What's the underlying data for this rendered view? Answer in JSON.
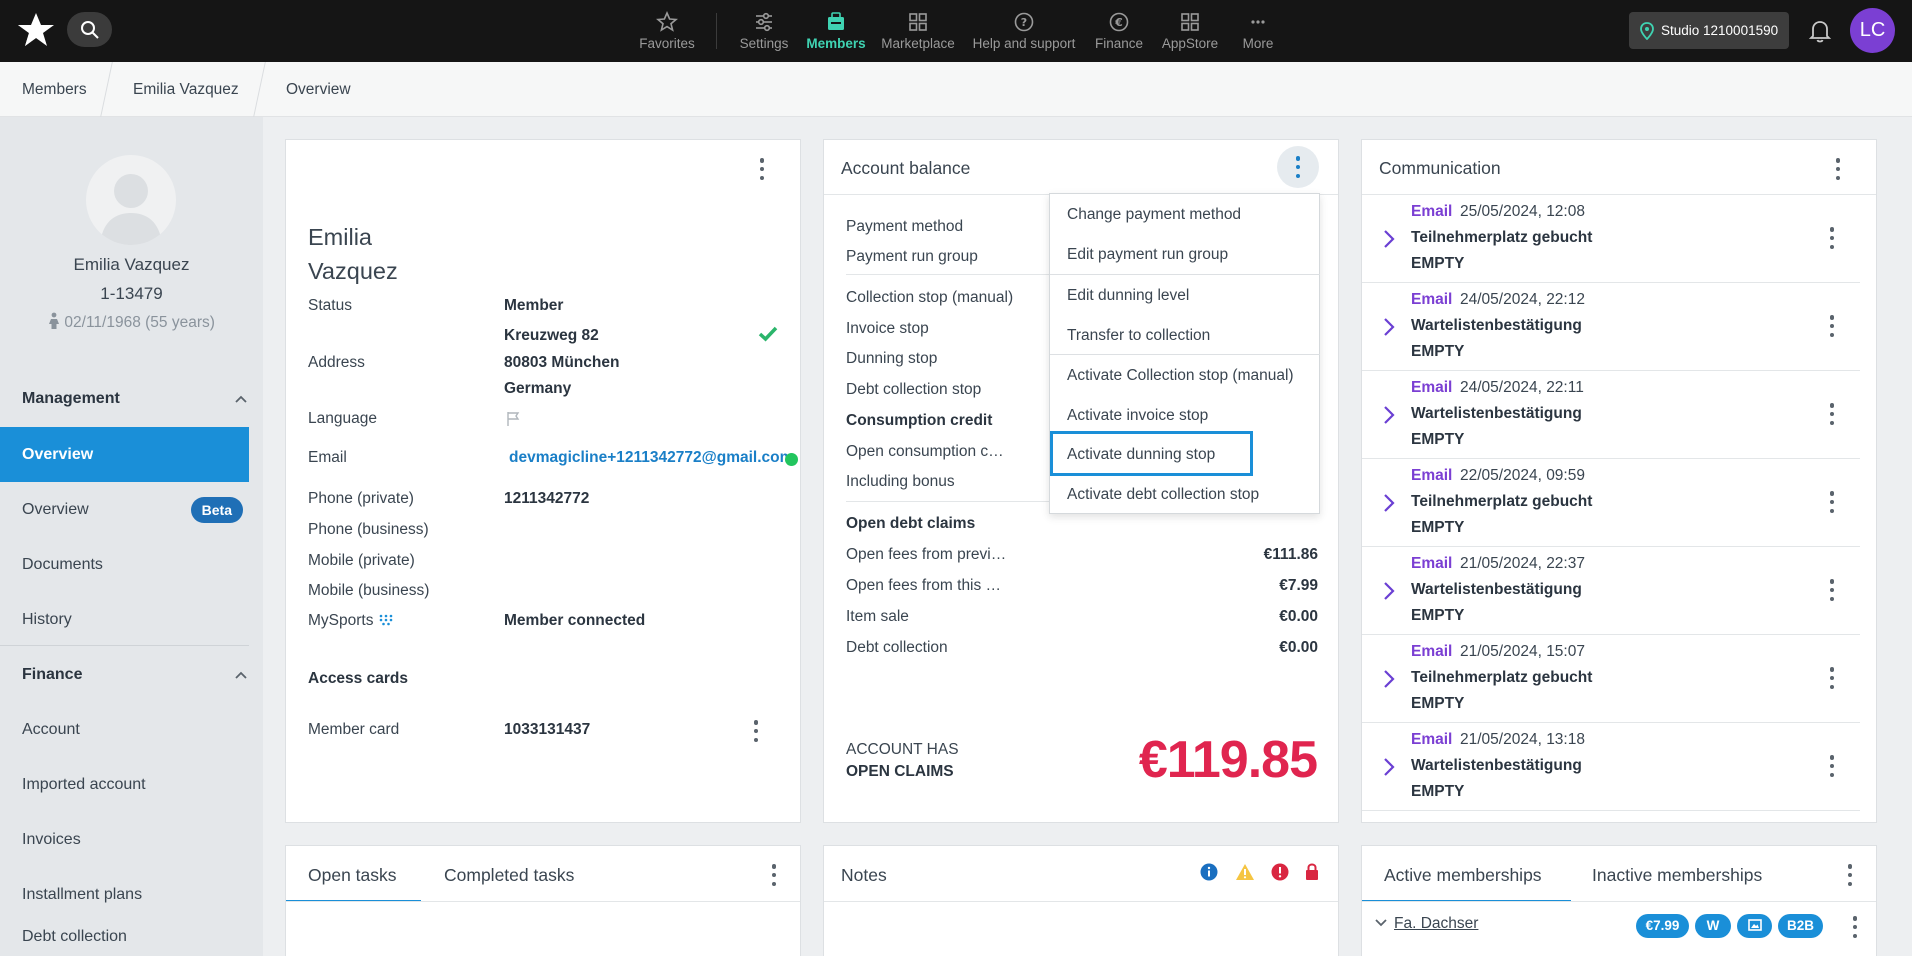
{
  "topbar": {
    "nav": [
      {
        "label": "Favorites",
        "icon": "star-icon"
      },
      {
        "label": "Settings",
        "icon": "sliders-icon"
      },
      {
        "label": "Members",
        "icon": "members-icon"
      },
      {
        "label": "Marketplace",
        "icon": "grid-icon"
      },
      {
        "label": "Help and support",
        "icon": "help-icon"
      },
      {
        "label": "Finance",
        "icon": "euro-icon"
      },
      {
        "label": "AppStore",
        "icon": "appstore-icon"
      },
      {
        "label": "More",
        "icon": "more-icon"
      }
    ],
    "studio": "Studio 1210001590",
    "user_initials": "LC",
    "accent": "#3fd3b2"
  },
  "breadcrumb": [
    "Members",
    "Emilia Vazquez",
    "Overview"
  ],
  "sidebar": {
    "name": "Emilia Vazquez",
    "member_number": "1-13479",
    "birthdate": "02/11/1968 (55 years)",
    "sections": [
      {
        "title": "Management",
        "items": [
          "Overview",
          "Overview",
          "Documents",
          "History"
        ],
        "badge": "Beta"
      },
      {
        "title": "Finance",
        "items": [
          "Account",
          "Imported account",
          "Invoices",
          "Installment plans",
          "Debt collection"
        ]
      }
    ]
  },
  "member_card": {
    "first_name": "Emilia",
    "last_name": "Vazquez",
    "fields": [
      {
        "label": "Status",
        "value": "Member"
      },
      {
        "label": "Address",
        "value_lines": [
          "Kreuzweg 82",
          "80803 München",
          "Germany"
        ]
      },
      {
        "label": "Language",
        "value": ""
      },
      {
        "label": "Email",
        "value": "devmagicline+1211342772@gmail.com"
      },
      {
        "label": "Phone (private)",
        "value": "1211342772"
      },
      {
        "label": "Phone (business)",
        "value": ""
      },
      {
        "label": "Mobile (private)",
        "value": ""
      },
      {
        "label": "Mobile (business)",
        "value": ""
      },
      {
        "label": "MySports",
        "value": "Member connected"
      }
    ],
    "access_cards_title": "Access cards",
    "member_card_label": "Member card",
    "member_card_value": "1033131437"
  },
  "account_balance": {
    "title": "Account balance",
    "rows": [
      "Payment method",
      "Payment run group",
      "Collection stop (manual)",
      "Invoice stop",
      "Dunning stop",
      "Debt collection stop",
      "Consumption credit",
      "Open consumption c…",
      "Including bonus",
      "Open debt claims"
    ],
    "fees": [
      {
        "label": "Open fees from previ…",
        "value": "€111.86"
      },
      {
        "label": "Open fees from this …",
        "value": "€7.99"
      },
      {
        "label": "Item sale",
        "value": "€0.00"
      },
      {
        "label": "Debt collection",
        "value": "€0.00"
      }
    ],
    "status_line1": "ACCOUNT HAS",
    "status_line2": "OPEN CLAIMS",
    "total": "€119.85",
    "total_color": "#e0254f"
  },
  "menu": {
    "items": [
      "Change payment method",
      "Edit payment run group",
      "Edit dunning level",
      "Transfer to collection",
      "Activate Collection stop (manual)",
      "Activate invoice stop",
      "Activate dunning stop",
      "Activate debt collection stop"
    ],
    "highlighted": "Activate dunning stop"
  },
  "communication": {
    "title": "Communication",
    "entries": [
      {
        "type": "Email",
        "date": "25/05/2024, 12:08",
        "subject": "Teilnehmerplatz gebucht",
        "body": "EMPTY"
      },
      {
        "type": "Email",
        "date": "24/05/2024, 22:12",
        "subject": "Wartelistenbestätigung",
        "body": "EMPTY"
      },
      {
        "type": "Email",
        "date": "24/05/2024, 22:11",
        "subject": "Wartelistenbestätigung",
        "body": "EMPTY"
      },
      {
        "type": "Email",
        "date": "22/05/2024, 09:59",
        "subject": "Teilnehmerplatz gebucht",
        "body": "EMPTY"
      },
      {
        "type": "Email",
        "date": "21/05/2024, 22:37",
        "subject": "Wartelistenbestätigung",
        "body": "EMPTY"
      },
      {
        "type": "Email",
        "date": "21/05/2024, 15:07",
        "subject": "Teilnehmerplatz gebucht",
        "body": "EMPTY"
      },
      {
        "type": "Email",
        "date": "21/05/2024, 13:18",
        "subject": "Wartelistenbestätigung",
        "body": "EMPTY"
      }
    ]
  },
  "tasks": {
    "tabs": [
      "Open tasks",
      "Completed tasks"
    ]
  },
  "notes": {
    "title": "Notes"
  },
  "memberships": {
    "tabs": [
      "Active memberships",
      "Inactive memberships"
    ],
    "item_name": "Fa. Dachser",
    "badges": [
      "€7.99",
      "W",
      "B2B"
    ]
  }
}
